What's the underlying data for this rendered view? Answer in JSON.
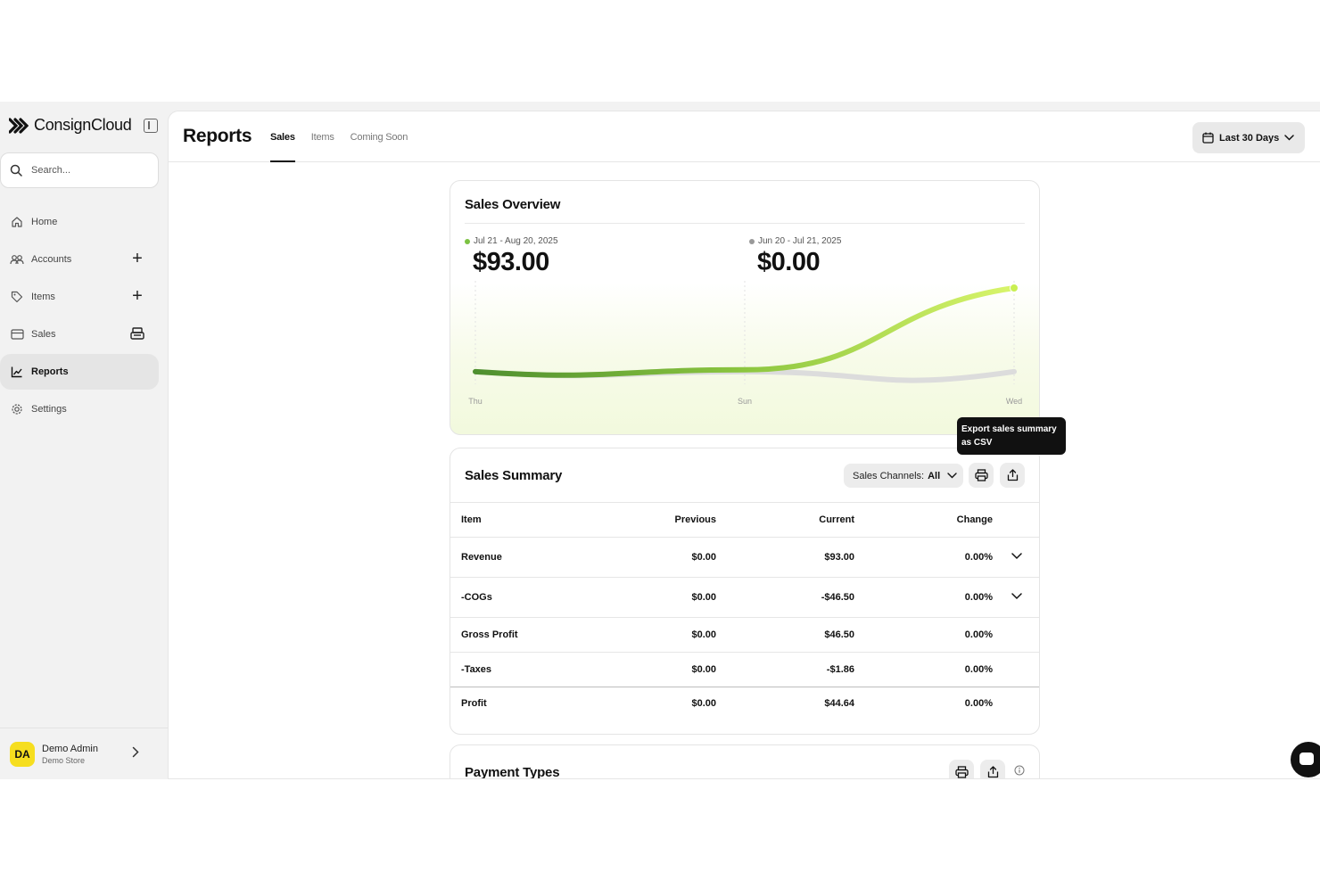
{
  "app": {
    "name": "ConsignCloud"
  },
  "search": {
    "placeholder": "Search..."
  },
  "sidebar": {
    "items": [
      {
        "label": "Home",
        "icon": "home-icon"
      },
      {
        "label": "Accounts",
        "icon": "users-icon"
      },
      {
        "label": "Items",
        "icon": "tag-icon"
      },
      {
        "label": "Sales",
        "icon": "card-icon"
      },
      {
        "label": "Reports",
        "icon": "chart-icon",
        "active": true
      },
      {
        "label": "Settings",
        "icon": "gear-icon"
      }
    ]
  },
  "user": {
    "initials": "DA",
    "name": "Demo Admin",
    "store": "Demo Store"
  },
  "header": {
    "title": "Reports",
    "tabs": [
      {
        "label": "Sales",
        "active": true
      },
      {
        "label": "Items"
      },
      {
        "label": "Coming Soon"
      }
    ],
    "date_range": "Last 30 Days"
  },
  "overview": {
    "title": "Sales Overview",
    "current": {
      "period": "Jul 21 - Aug 20, 2025",
      "amount": "$93.00",
      "color": "#7cc242"
    },
    "previous": {
      "period": "Jun 20 - Jul 21, 2025",
      "amount": "$0.00",
      "color": "#999999"
    }
  },
  "chart_data": {
    "type": "line",
    "x": [
      "Thu",
      "Sun",
      "Wed"
    ],
    "x_ticks": [
      "Thu",
      "Sun",
      "Wed"
    ],
    "series": [
      {
        "values": [
          0,
          2,
          93
        ],
        "color_start": "#4f8f2f",
        "color_end": "#d9f56b"
      },
      {
        "values": [
          0,
          0,
          0
        ],
        "color": "#dcdcdc"
      }
    ],
    "ylim": [
      -20,
      93
    ],
    "grid": false
  },
  "summary": {
    "title": "Sales Summary",
    "channel_label": "Sales Channels:",
    "channel_value": "All",
    "columns": [
      "Item",
      "Previous",
      "Current",
      "Change"
    ],
    "rows": [
      {
        "item": "Revenue",
        "previous": "$0.00",
        "current": "$93.00",
        "change": "0.00%",
        "expandable": true
      },
      {
        "item": "-COGs",
        "previous": "$0.00",
        "current": "-$46.50",
        "change": "0.00%",
        "expandable": true
      },
      {
        "item": "Gross Profit",
        "previous": "$0.00",
        "current": "$46.50",
        "change": "0.00%"
      },
      {
        "item": "-Taxes",
        "previous": "$0.00",
        "current": "-$1.86",
        "change": "0.00%"
      },
      {
        "item": "Profit",
        "previous": "$0.00",
        "current": "$44.64",
        "change": "0.00%"
      }
    ]
  },
  "payment": {
    "title": "Payment Types"
  },
  "tooltip": {
    "text": "Export sales summary as CSV"
  }
}
